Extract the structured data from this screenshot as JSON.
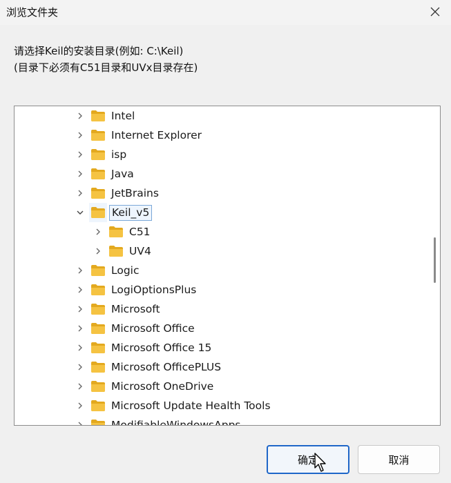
{
  "window": {
    "title": "浏览文件夹"
  },
  "prompt": {
    "line1": "请选择Keil的安装目录(例如: C:\\Keil)",
    "line2": "(目录下必须有C51目录和UVx目录存在)"
  },
  "tree": {
    "items": [
      {
        "label": "Intel",
        "level": 0,
        "expanded": false,
        "selected": false
      },
      {
        "label": "Internet Explorer",
        "level": 0,
        "expanded": false,
        "selected": false
      },
      {
        "label": "isp",
        "level": 0,
        "expanded": false,
        "selected": false
      },
      {
        "label": "Java",
        "level": 0,
        "expanded": false,
        "selected": false
      },
      {
        "label": "JetBrains",
        "level": 0,
        "expanded": false,
        "selected": false
      },
      {
        "label": "Keil_v5",
        "level": 0,
        "expanded": true,
        "selected": true
      },
      {
        "label": "C51",
        "level": 1,
        "expanded": false,
        "selected": false
      },
      {
        "label": "UV4",
        "level": 1,
        "expanded": false,
        "selected": false
      },
      {
        "label": "Logic",
        "level": 0,
        "expanded": false,
        "selected": false
      },
      {
        "label": "LogiOptionsPlus",
        "level": 0,
        "expanded": false,
        "selected": false
      },
      {
        "label": "Microsoft",
        "level": 0,
        "expanded": false,
        "selected": false
      },
      {
        "label": "Microsoft Office",
        "level": 0,
        "expanded": false,
        "selected": false
      },
      {
        "label": "Microsoft Office 15",
        "level": 0,
        "expanded": false,
        "selected": false
      },
      {
        "label": "Microsoft OfficePLUS",
        "level": 0,
        "expanded": false,
        "selected": false
      },
      {
        "label": "Microsoft OneDrive",
        "level": 0,
        "expanded": false,
        "selected": false
      },
      {
        "label": "Microsoft Update Health Tools",
        "level": 0,
        "expanded": false,
        "selected": false
      },
      {
        "label": "ModifiableWindowsApps",
        "level": 0,
        "expanded": false,
        "selected": false
      }
    ]
  },
  "buttons": {
    "ok": "确定",
    "cancel": "取消"
  },
  "colors": {
    "folder": "#f5c342",
    "folder_dark": "#e3a91f",
    "accent": "#1e66c8"
  }
}
